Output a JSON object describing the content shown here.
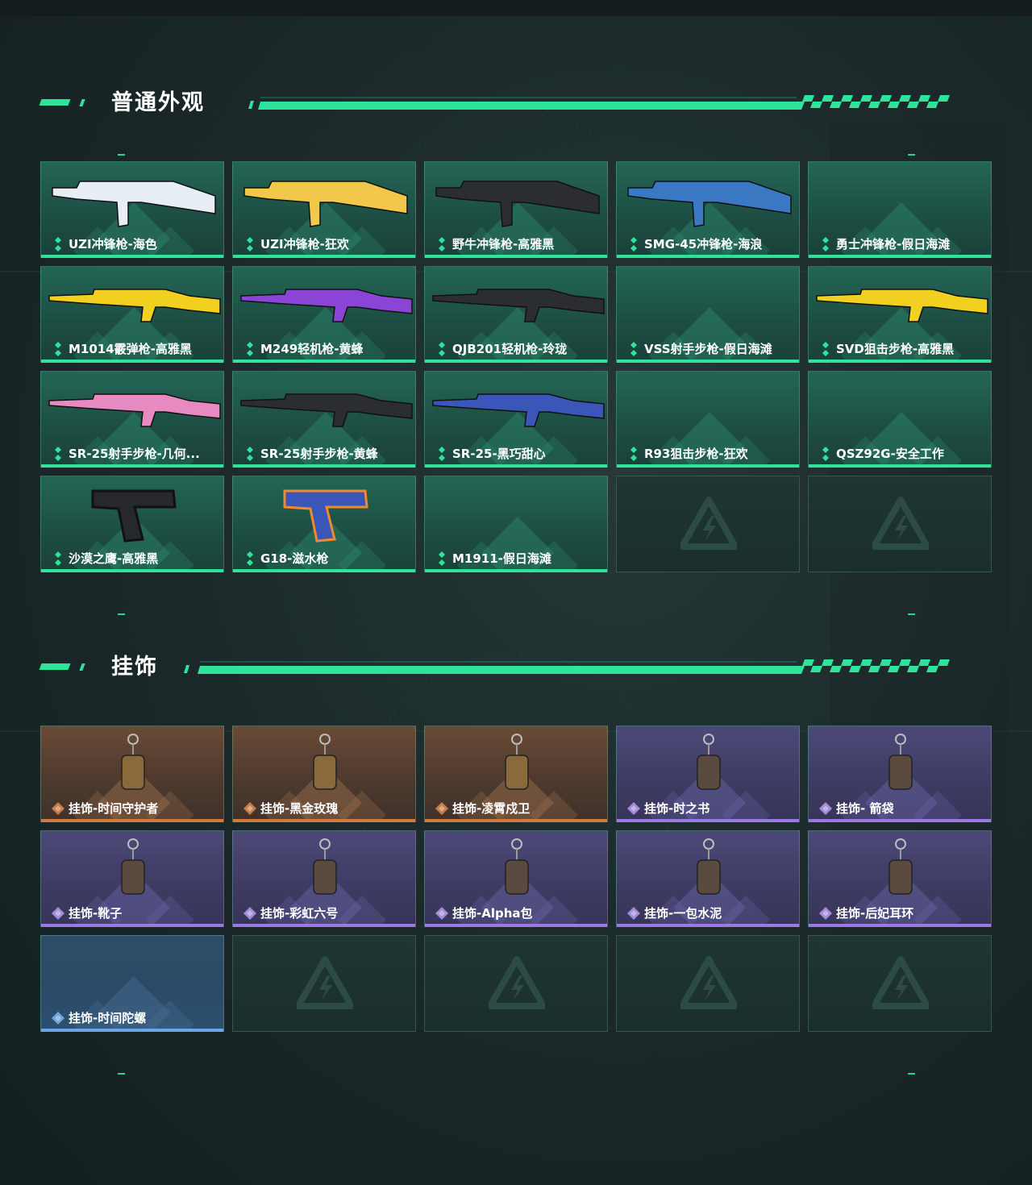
{
  "sections": [
    {
      "title": "普通外观",
      "items": [
        {
          "label": "UZI冲锋枪-海色",
          "rarity": "green",
          "icon": "uzi-smg-icon"
        },
        {
          "label": "UZI冲锋枪-狂欢",
          "rarity": "green",
          "icon": "uzi-smg-icon"
        },
        {
          "label": "野牛冲锋枪-高雅黑",
          "rarity": "green",
          "icon": "bizon-smg-icon"
        },
        {
          "label": "SMG-45冲锋枪-海浪",
          "rarity": "green",
          "icon": "smg-icon"
        },
        {
          "label": "勇士冲锋枪-假日海滩",
          "rarity": "green",
          "icon": ""
        },
        {
          "label": "M1014霰弹枪-高雅黑",
          "rarity": "green",
          "icon": "shotgun-icon"
        },
        {
          "label": "M249轻机枪-黄蜂",
          "rarity": "green",
          "icon": "lmg-icon"
        },
        {
          "label": "QJB201轻机枪-玲珑",
          "rarity": "green",
          "icon": "lmg-icon"
        },
        {
          "label": "VSS射手步枪-假日海滩",
          "rarity": "green",
          "icon": ""
        },
        {
          "label": "SVD狙击步枪-高雅黑",
          "rarity": "green",
          "icon": "sniper-rifle-icon"
        },
        {
          "label": "SR-25射手步枪-几何...",
          "rarity": "green",
          "icon": "marksman-rifle-icon"
        },
        {
          "label": "SR-25射手步枪-黄蜂",
          "rarity": "green",
          "icon": "marksman-rifle-icon"
        },
        {
          "label": "SR-25-黑巧甜心",
          "rarity": "green",
          "icon": "marksman-rifle-icon"
        },
        {
          "label": "R93狙击步枪-狂欢",
          "rarity": "green",
          "icon": ""
        },
        {
          "label": "QSZ92G-安全工作",
          "rarity": "green",
          "icon": ""
        },
        {
          "label": "沙漠之鹰-高雅黑",
          "rarity": "green",
          "icon": "pistol-icon"
        },
        {
          "label": "G18-滋水枪",
          "rarity": "green",
          "icon": "water-pistol-icon"
        },
        {
          "label": "M1911-假日海滩",
          "rarity": "green",
          "icon": ""
        },
        {
          "label": "",
          "rarity": "empty",
          "icon": ""
        },
        {
          "label": "",
          "rarity": "empty",
          "icon": ""
        }
      ]
    },
    {
      "title": "挂饰",
      "items": [
        {
          "label": "挂饰-时间守护者",
          "rarity": "gold",
          "icon": "charm-icon"
        },
        {
          "label": "挂饰-黑金玫瑰",
          "rarity": "gold",
          "icon": "charm-icon"
        },
        {
          "label": "挂饰-凌霄戍卫",
          "rarity": "gold",
          "icon": "charm-icon"
        },
        {
          "label": "挂饰-时之书",
          "rarity": "purple",
          "icon": "charm-icon"
        },
        {
          "label": "挂饰- 箭袋",
          "rarity": "purple",
          "icon": "charm-icon"
        },
        {
          "label": "挂饰-靴子",
          "rarity": "purple",
          "icon": "charm-icon"
        },
        {
          "label": "挂饰-彩虹六号",
          "rarity": "purple",
          "icon": "charm-icon"
        },
        {
          "label": "挂饰-Alpha包",
          "rarity": "purple",
          "icon": "charm-icon"
        },
        {
          "label": "挂饰-一包水泥",
          "rarity": "purple",
          "icon": "charm-icon"
        },
        {
          "label": "挂饰-后妃耳环",
          "rarity": "purple",
          "icon": "charm-icon"
        },
        {
          "label": "挂饰-时间陀螺",
          "rarity": "blue",
          "icon": ""
        },
        {
          "label": "",
          "rarity": "empty",
          "icon": ""
        },
        {
          "label": "",
          "rarity": "empty",
          "icon": ""
        },
        {
          "label": "",
          "rarity": "empty",
          "icon": ""
        },
        {
          "label": "",
          "rarity": "empty",
          "icon": ""
        }
      ]
    }
  ],
  "colors": {
    "accent": "#2ee39a",
    "green_rarity": "#2ee39a",
    "gold_rarity": "#d27a3c",
    "purple_rarity": "#9a79e0",
    "blue_rarity": "#6aa6e6"
  }
}
